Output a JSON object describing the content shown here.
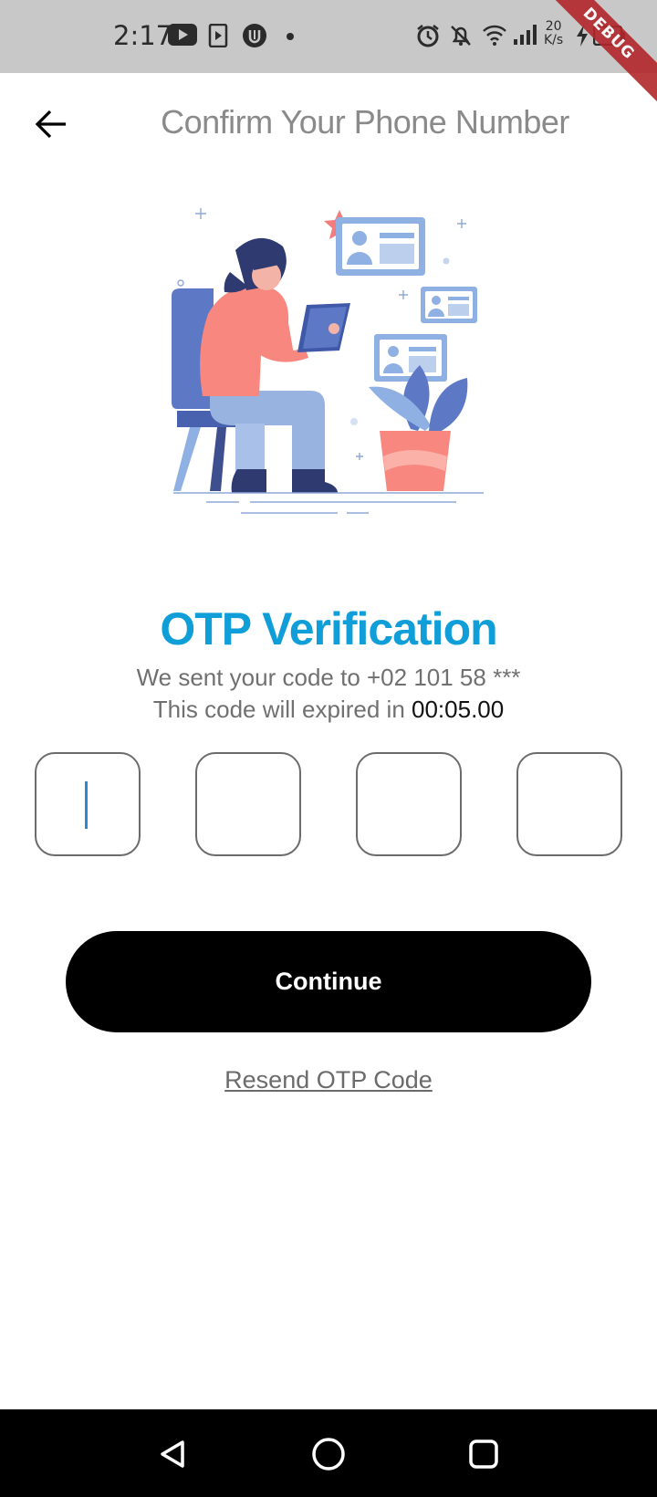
{
  "status_bar": {
    "time": "2:17",
    "net_speed_value": "20",
    "net_speed_unit": "K/s",
    "icons": [
      "youtube-icon",
      "media-icon",
      "shield-icon",
      "dot-icon",
      "alarm-icon",
      "bell-off-icon",
      "wifi-icon",
      "signal-icon",
      "charging-icon",
      "battery-icon"
    ]
  },
  "debug_banner": "DEBUG",
  "header": {
    "back_icon": "arrow-left-icon",
    "title": "Confirm Your Phone Number"
  },
  "illustration": {
    "icon": "woman-with-tablet-illustration"
  },
  "otp": {
    "title": "OTP Verification",
    "sent_text": "We sent your code to +02 101 58 ***",
    "expire_text": "This code will expired in",
    "timer": "00:05.00",
    "digits": [
      "",
      "",
      "",
      ""
    ]
  },
  "continue_label": "Continue",
  "resend_label": "Resend OTP Code",
  "colors": {
    "accent": "#0f9ed8",
    "title_gray": "#8a8a8a",
    "button_bg": "#000000",
    "status_bar": "#c8c8c8"
  },
  "nav": {
    "back_icon": "triangle-back-icon",
    "home_icon": "circle-home-icon",
    "recents_icon": "square-recents-icon"
  }
}
